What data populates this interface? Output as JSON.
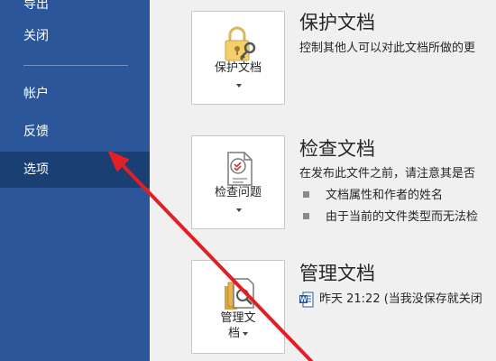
{
  "sidebar": {
    "items": [
      {
        "label": "导出",
        "selected": false
      },
      {
        "label": "关闭",
        "selected": false
      },
      {
        "label": "帐户",
        "selected": false
      },
      {
        "label": "反馈",
        "selected": false
      },
      {
        "label": "选项",
        "selected": true
      }
    ],
    "bg_color": "#2b579a",
    "selected_color": "#1a3f73"
  },
  "sections": {
    "protect": {
      "tile_label": "保护文档",
      "title": "保护文档",
      "description": "控制其他人可以对此文档所做的更"
    },
    "inspect": {
      "tile_label": "检查问题",
      "title": "检查文档",
      "description": "在发布此文件之前，请注意其是否",
      "bullets": [
        "文档属性和作者的姓名",
        "由于当前的文件类型而无法检"
      ]
    },
    "manage": {
      "tile_label_line1": "管理文",
      "tile_label_line2": "档",
      "title": "管理文档",
      "version_text": "昨天 21:22 (当我没保存就关闭"
    }
  },
  "annotation": {
    "type": "arrow",
    "color": "#e31e24"
  }
}
